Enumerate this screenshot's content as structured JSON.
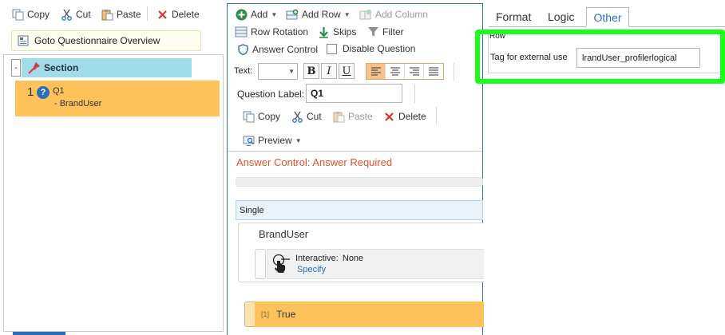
{
  "left": {
    "toolbar": {
      "copy": "Copy",
      "cut": "Cut",
      "paste": "Paste",
      "delete": "Delete"
    },
    "goto_button": "Goto Questionnaire Overview",
    "tree": {
      "collapse_symbol": "-",
      "section_label": "Section",
      "question": {
        "number": "1",
        "id": "Q1",
        "subtitle": "- BrandUser"
      }
    }
  },
  "middle": {
    "toolbar_row1": {
      "add": "Add",
      "add_row": "Add Row",
      "add_column": "Add Column"
    },
    "toolbar_row2": {
      "row_rotation": "Row Rotation",
      "skips": "Skips",
      "filter": "Filter"
    },
    "toolbar_row3": {
      "answer_control": "Answer Control",
      "disable_question": "Disable Question"
    },
    "text_format": {
      "label": "Text:",
      "bold": "B",
      "italic": "I",
      "underline": "U"
    },
    "question_label": {
      "label": "Question Label:",
      "value": "Q1"
    },
    "edit_toolbar": {
      "copy": "Copy",
      "cut": "Cut",
      "paste": "Paste",
      "delete": "Delete"
    },
    "preview": "Preview",
    "canvas": {
      "answer_required": "Answer Control: Answer Required",
      "question_type": "Single",
      "row_text": "BrandUser",
      "interactive_label": "Interactive:",
      "interactive_value": "None",
      "specify_link": "Specify",
      "answer_index": "[1]",
      "answer_text": "True"
    }
  },
  "right": {
    "tabs": {
      "format": "Format",
      "logic": "Logic",
      "other": "Other"
    },
    "group_header": "Row",
    "tag_label": "Tag for external use",
    "tag_value": "lrandUser_profilerlogical"
  },
  "colors": {
    "accent_blue": "#2a6fb8",
    "section_cyan": "#9fdbe8",
    "question_orange": "#fdc35a",
    "warning_orange": "#e0522a",
    "highlight_green": "#19ff19"
  }
}
